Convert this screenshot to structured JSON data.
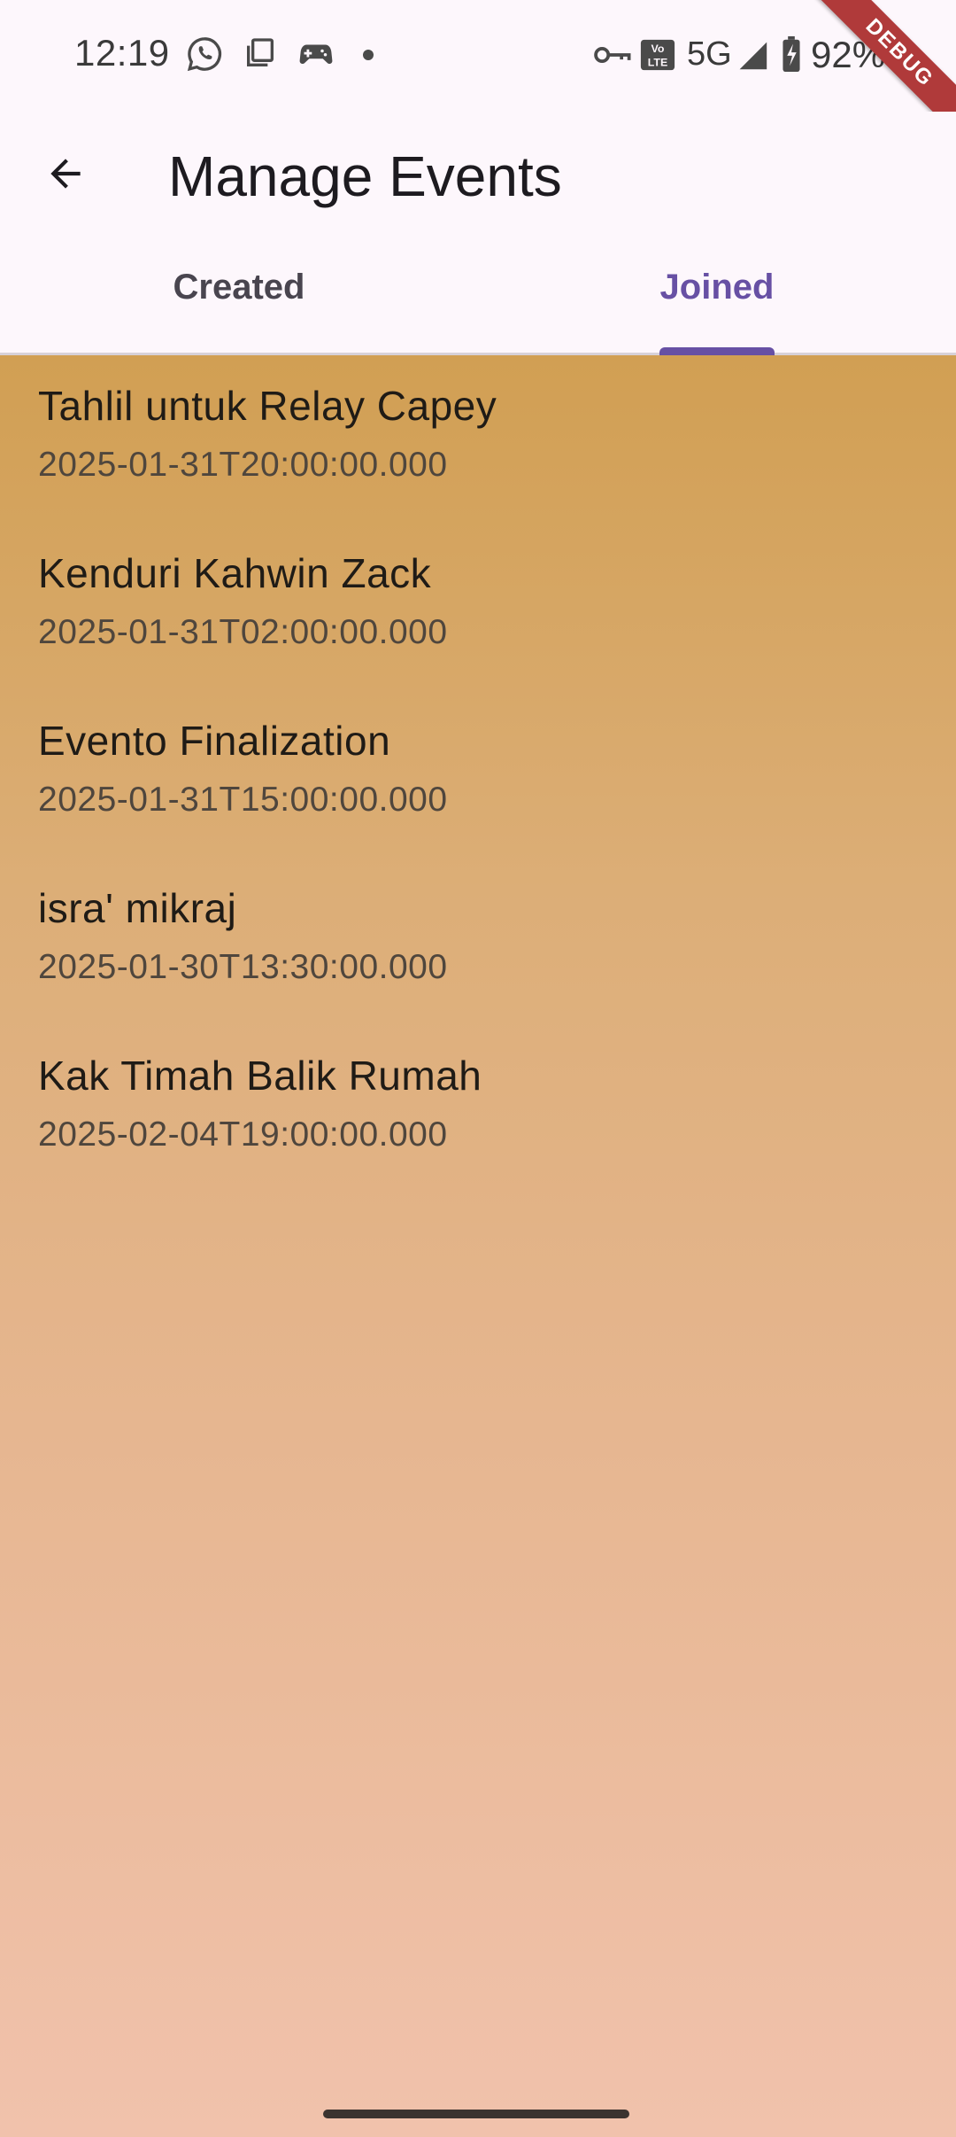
{
  "status_bar": {
    "time": "12:19",
    "network": "5G",
    "battery": "92%",
    "icons": [
      "whatsapp-icon",
      "copy-icon",
      "game-controller-icon",
      "dot-icon",
      "vpn-key-icon",
      "volte-icon",
      "signal-icon",
      "battery-charging-icon"
    ]
  },
  "debug_banner": {
    "label": "DEBUG"
  },
  "app_bar": {
    "title": "Manage Events",
    "back_icon": "arrow-back-icon"
  },
  "tabs": [
    {
      "label": "Created",
      "selected": false
    },
    {
      "label": "Joined",
      "selected": true
    }
  ],
  "events": [
    {
      "title": "Tahlil untuk Relay Capey",
      "date": "2025-01-31T20:00:00.000"
    },
    {
      "title": "Kenduri Kahwin Zack",
      "date": "2025-01-31T02:00:00.000"
    },
    {
      "title": "Evento Finalization",
      "date": "2025-01-31T15:00:00.000"
    },
    {
      "title": "isra' mikraj",
      "date": "2025-01-30T13:30:00.000"
    },
    {
      "title": "Kak Timah Balik Rumah",
      "date": "2025-02-04T19:00:00.000"
    }
  ],
  "colors": {
    "accent": "#6750a4",
    "gradient_top": "#d19f53",
    "gradient_bottom": "#f1c2ac",
    "debug_ribbon": "#b03a3a"
  }
}
